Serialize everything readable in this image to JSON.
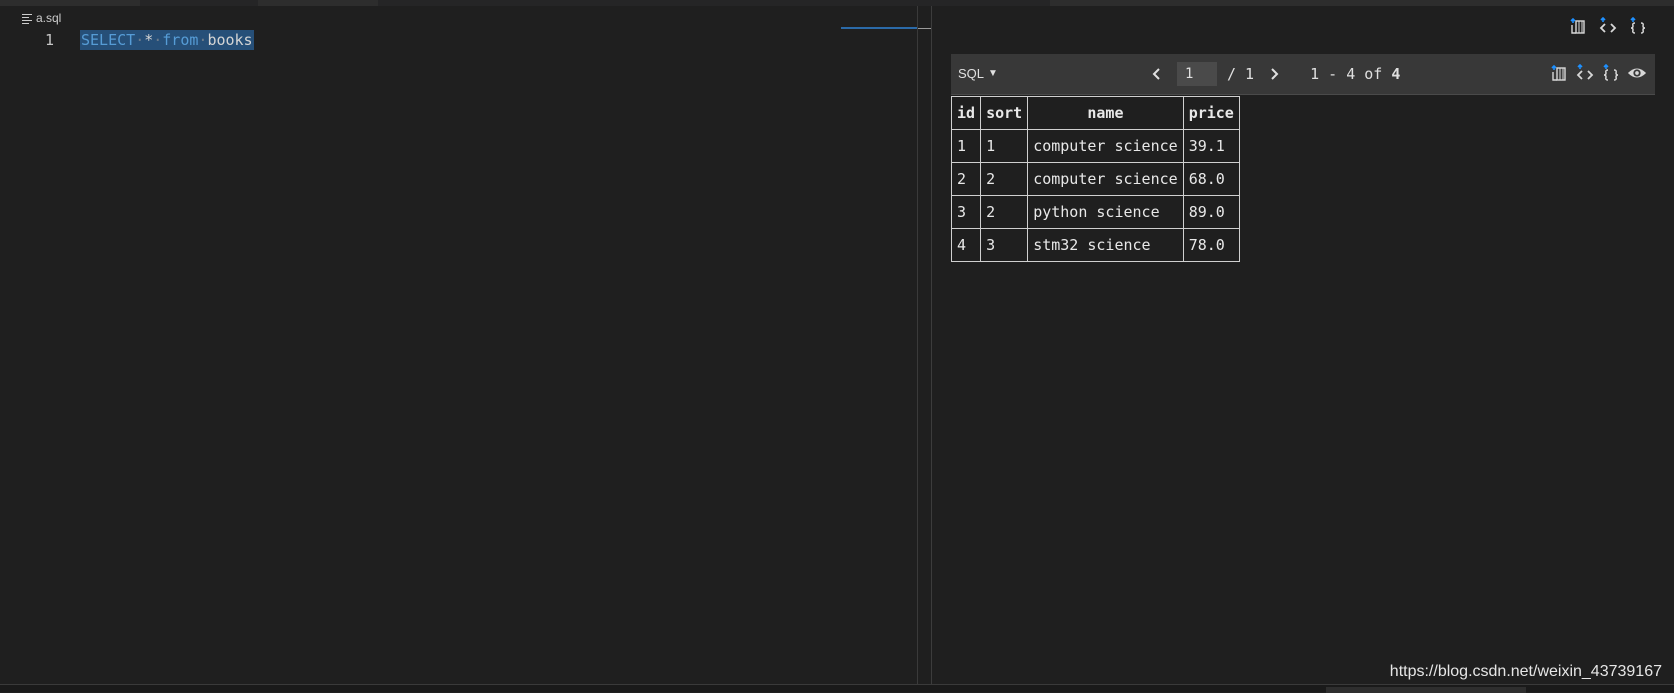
{
  "editor": {
    "file_name": "a.sql",
    "line_number": "1",
    "code": {
      "kw1": "SELECT",
      "op": "*",
      "kw2": "from",
      "ident": "books"
    }
  },
  "results": {
    "top_actions": [
      "export-icon",
      "code-icon",
      "json-icon"
    ],
    "language_label": "SQL",
    "pager": {
      "current_page": "1",
      "total_pages": "/ 1",
      "range": "1 - 4 of",
      "total_rows": "4"
    },
    "toolbar_actions": [
      "export-icon",
      "code-icon",
      "json-icon",
      "eye-icon"
    ],
    "table": {
      "columns": [
        "id",
        "sort",
        "name",
        "price"
      ],
      "rows": [
        [
          "1",
          "1",
          "computer science",
          "39.1"
        ],
        [
          "2",
          "2",
          "computer science",
          "68.0"
        ],
        [
          "3",
          "2",
          "python science",
          "89.0"
        ],
        [
          "4",
          "3",
          "stm32 science",
          "78.0"
        ]
      ]
    }
  },
  "watermark": "https://blog.csdn.net/weixin_43739167",
  "colors": {
    "background": "#1f1f1f",
    "selection": "#264f78",
    "keyword": "#569cd6",
    "icon_accent": "#1e90ff",
    "toolbar": "#383838"
  }
}
